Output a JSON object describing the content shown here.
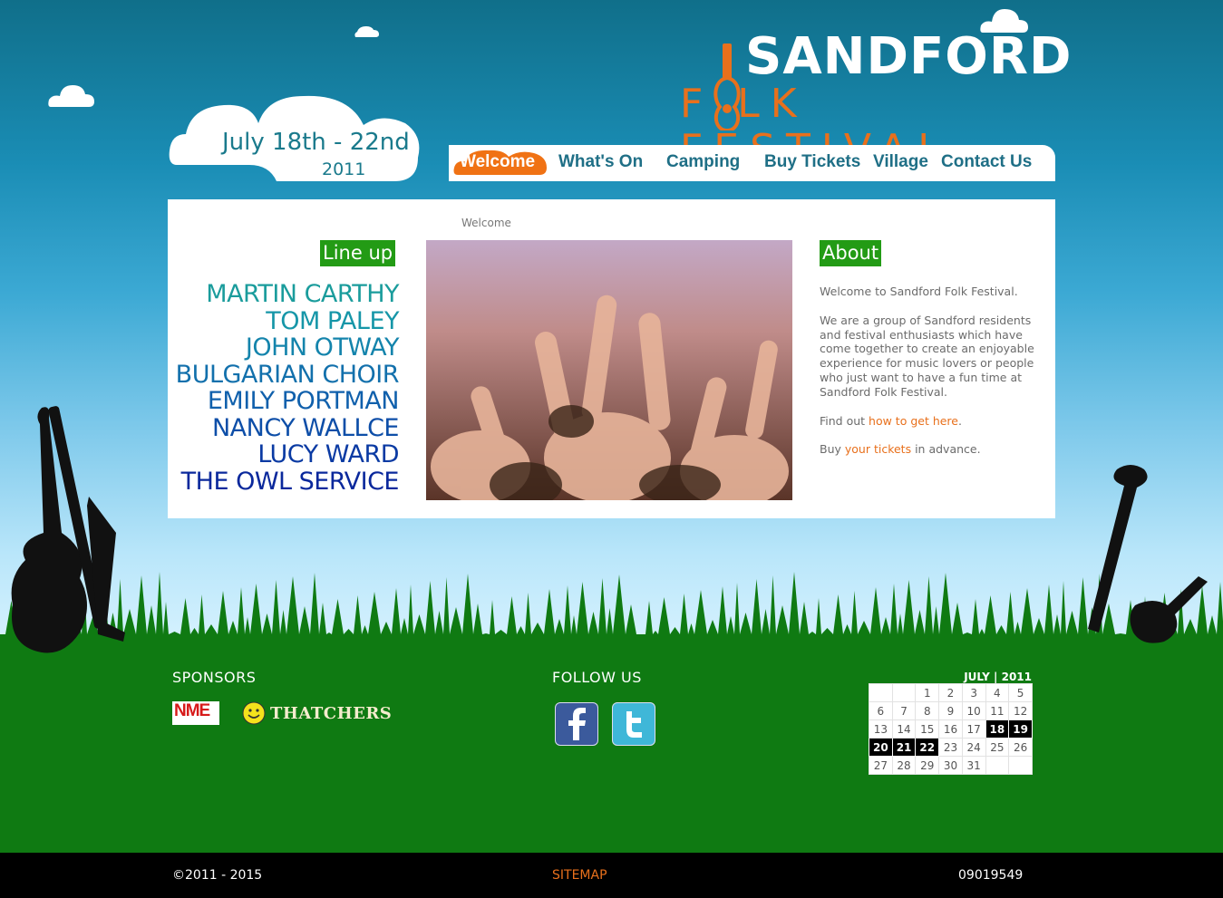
{
  "logo": {
    "line1": "SANDFORD",
    "line2": "F LK FESTIVAL"
  },
  "dates": {
    "line1": "July 18th - 22nd",
    "line2": "2011"
  },
  "nav": {
    "items": [
      {
        "label": "Welcome",
        "active": true
      },
      {
        "label": "What's On"
      },
      {
        "label": "Camping"
      },
      {
        "label": "Buy Tickets"
      },
      {
        "label": "Village"
      },
      {
        "label": "Contact Us"
      }
    ]
  },
  "breadcrumb": "Welcome",
  "lineup": {
    "title": "Line up",
    "artists": [
      {
        "name": "MARTIN CARTHY",
        "color": "#1a9c9c"
      },
      {
        "name": "TOM PALEY",
        "color": "#1696a8"
      },
      {
        "name": "JOHN OTWAY",
        "color": "#1484ac"
      },
      {
        "name": "BULGARIAN CHOIR",
        "color": "#1270ac"
      },
      {
        "name": "EMILY PORTMAN",
        "color": "#1060ac"
      },
      {
        "name": "NANCY WALLCE",
        "color": "#0d4ea8"
      },
      {
        "name": "LUCY WARD",
        "color": "#0a3aa3"
      },
      {
        "name": "THE OWL SERVICE",
        "color": "#0a289c"
      }
    ]
  },
  "about": {
    "title": "About",
    "p1": "Welcome to Sandford Folk Festival.",
    "p2": "We are a group of Sandford residents and festival enthusiasts which have come together to create an enjoyable experience for music lovers or people who just want to have a fun time at Sandford Folk Festival.",
    "p3_pre": "Find out ",
    "p3_link": "how to get here",
    "p3_post": ".",
    "p4_pre": "Buy ",
    "p4_link": "your tickets",
    "p4_post": " in advance."
  },
  "sponsors": {
    "title": "SPONSORS",
    "nme": "NME",
    "thatchers": "THATCHERS"
  },
  "follow": {
    "title": "FOLLOW US"
  },
  "calendar": {
    "title": "JULY | 2011",
    "weeks": [
      [
        "",
        "",
        "1",
        "2",
        "3",
        "4",
        "5"
      ],
      [
        "6",
        "7",
        "8",
        "9",
        "10",
        "11",
        "12"
      ],
      [
        "13",
        "14",
        "15",
        "16",
        "17",
        "18",
        "19"
      ],
      [
        "20",
        "21",
        "22",
        "23",
        "24",
        "25",
        "26"
      ],
      [
        "27",
        "28",
        "29",
        "30",
        "31",
        "",
        ""
      ]
    ],
    "highlighted": [
      "18",
      "19",
      "20",
      "21",
      "22"
    ]
  },
  "footer": {
    "copyright": "©2011 - 2015",
    "sitemap": "SITEMAP",
    "number": "09019549"
  },
  "colors": {
    "accent_orange": "#e8701c",
    "heading_green": "#239b15",
    "grass": "#0f7a12"
  }
}
